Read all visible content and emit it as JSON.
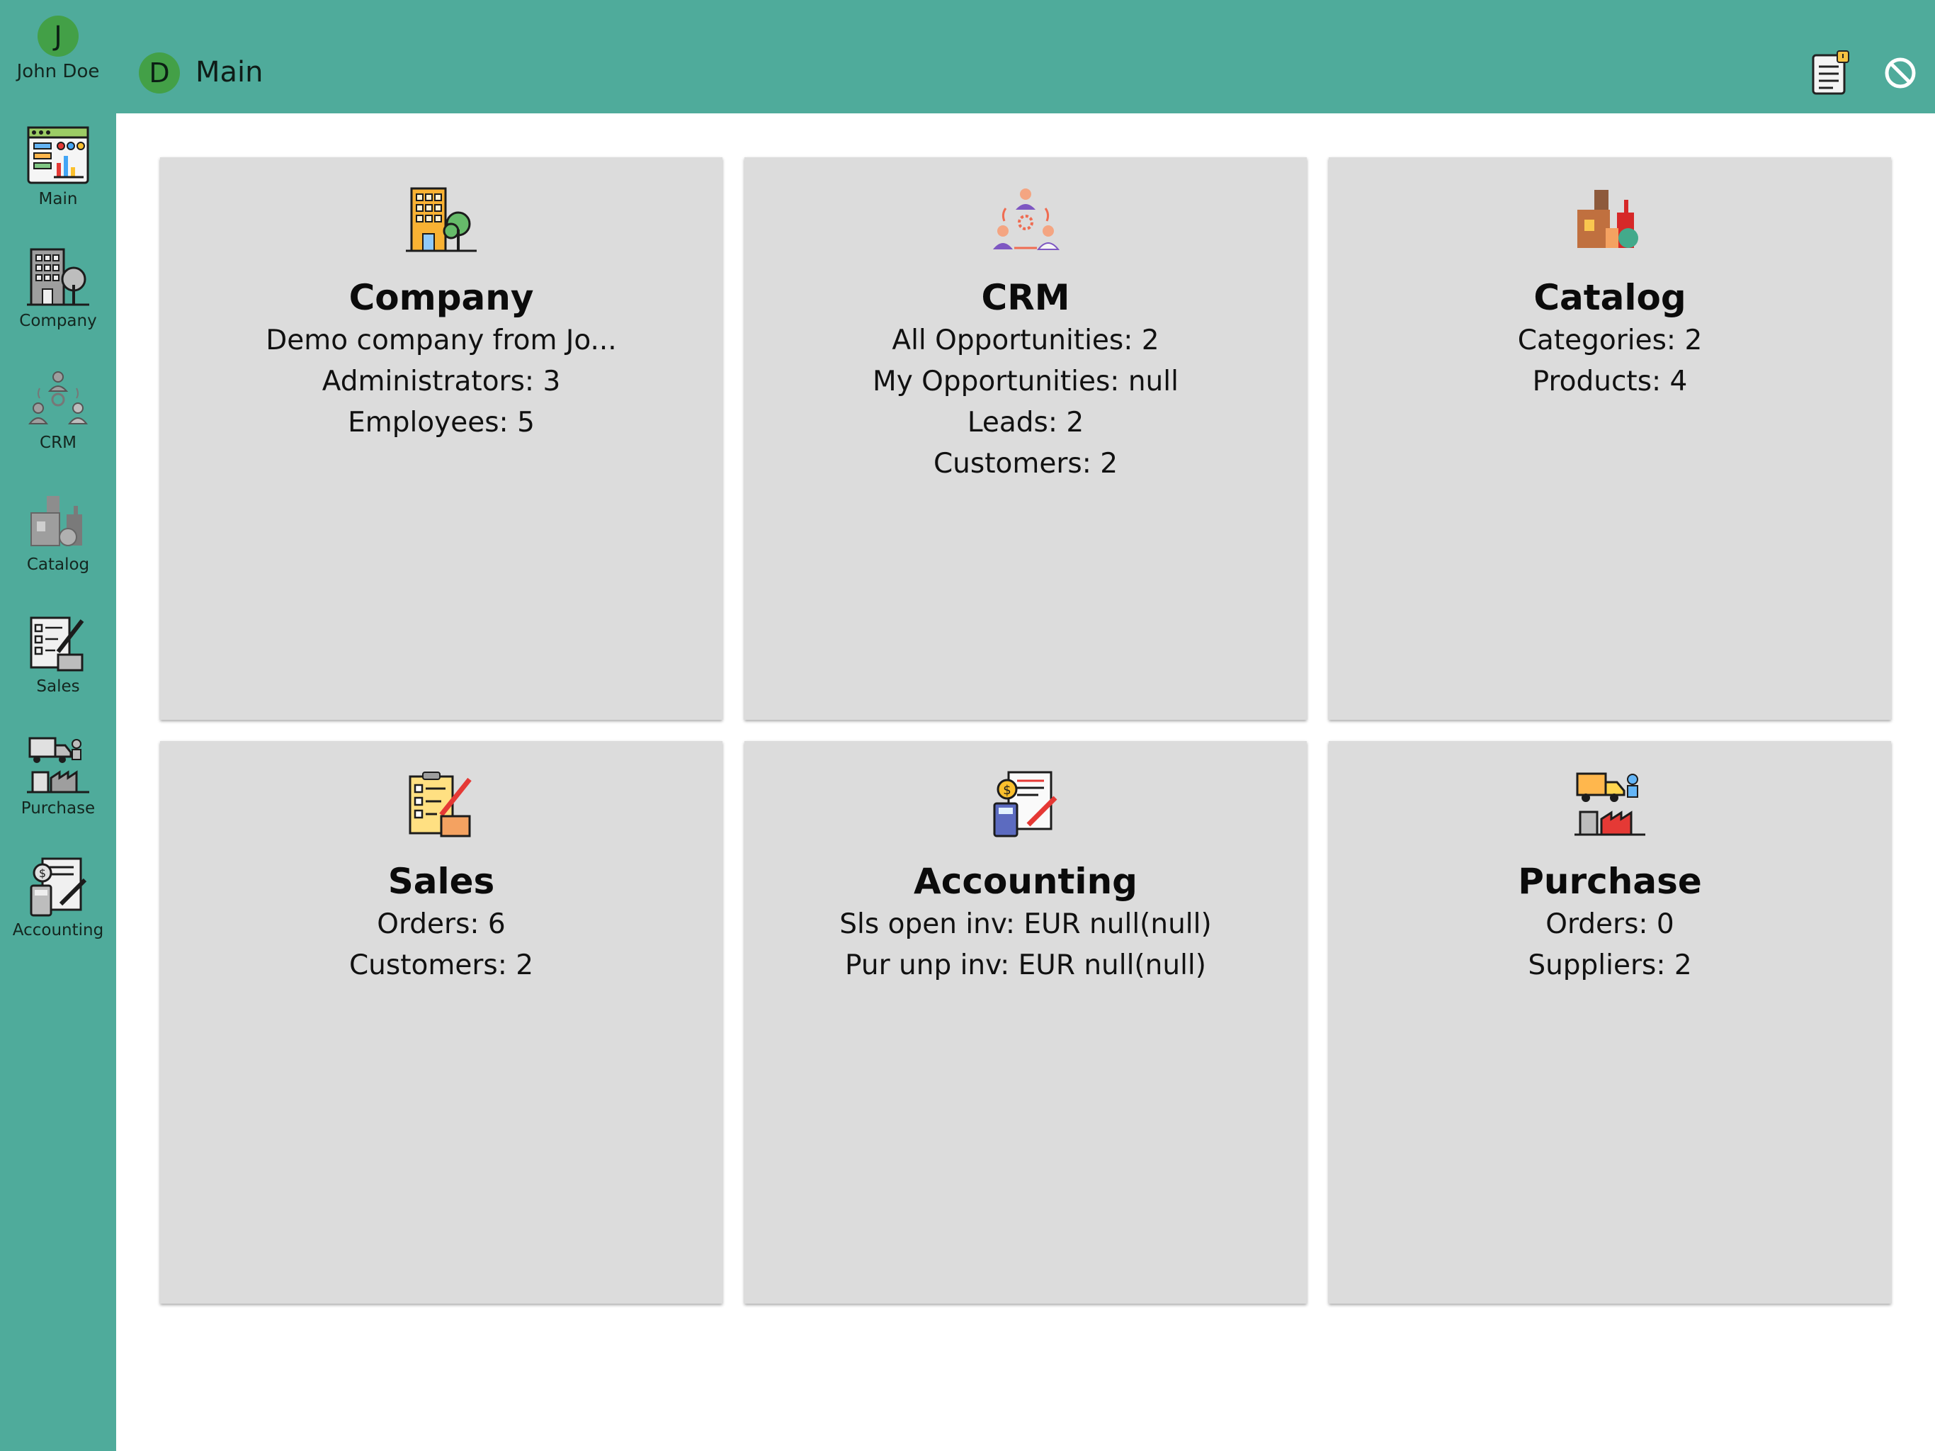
{
  "user": {
    "initial": "J",
    "name": "John Doe"
  },
  "header": {
    "company_initial": "D",
    "title": "Main",
    "notes_icon": "notepad-icon",
    "logout_icon": "block-icon"
  },
  "colors": {
    "bar": "#4fab9b",
    "avatar": "#43a047",
    "card": "#dcdcdc"
  },
  "sidebar": {
    "items": [
      {
        "label": "Main",
        "icon": "dashboard-icon"
      },
      {
        "label": "Company",
        "icon": "building-icon"
      },
      {
        "label": "CRM",
        "icon": "people-network-icon"
      },
      {
        "label": "Catalog",
        "icon": "products-icon"
      },
      {
        "label": "Sales",
        "icon": "checklist-icon"
      },
      {
        "label": "Purchase",
        "icon": "truck-icon"
      },
      {
        "label": "Accounting",
        "icon": "invoice-icon"
      }
    ]
  },
  "cards": [
    {
      "title": "Company",
      "icon": "building-icon",
      "lines": [
        "Demo company from Jo...",
        "Administrators: 3",
        "Employees: 5"
      ]
    },
    {
      "title": "CRM",
      "icon": "people-network-icon",
      "lines": [
        "All Opportunities: 2",
        "My Opportunities: null",
        "Leads: 2",
        "Customers: 2"
      ]
    },
    {
      "title": "Catalog",
      "icon": "products-icon",
      "lines": [
        "Categories: 2",
        "Products: 4"
      ]
    },
    {
      "title": "Sales",
      "icon": "checklist-icon",
      "lines": [
        "Orders: 6",
        "Customers: 2"
      ]
    },
    {
      "title": "Accounting",
      "icon": "invoice-icon",
      "lines": [
        "Sls open inv: EUR null(null)",
        "Pur unp inv: EUR null(null)"
      ]
    },
    {
      "title": "Purchase",
      "icon": "truck-icon",
      "lines": [
        "Orders: 0",
        "Suppliers: 2"
      ]
    }
  ]
}
